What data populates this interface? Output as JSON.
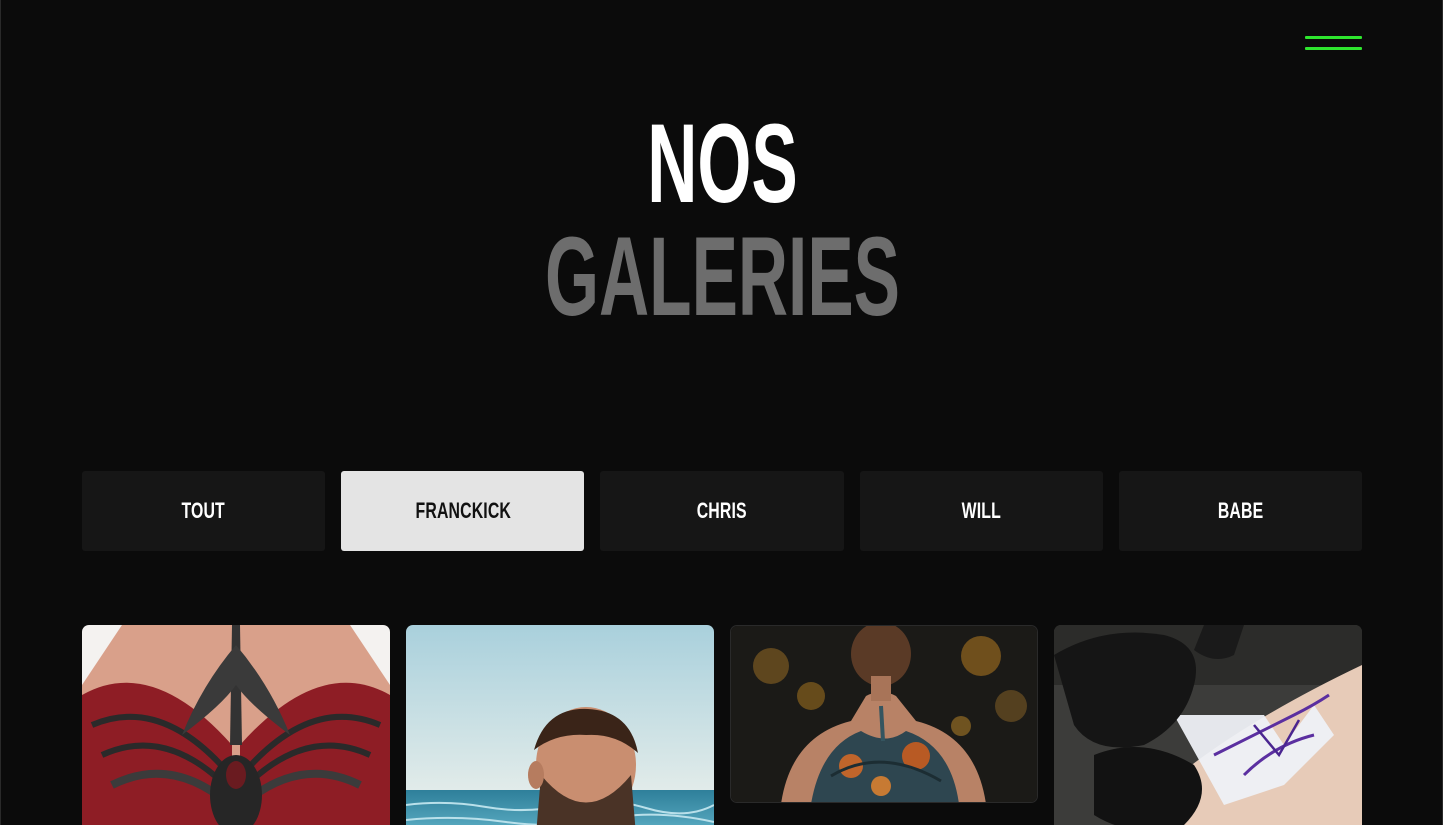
{
  "header": {
    "menu_icon": "hamburger-menu-icon",
    "accent_color": "#2ee62e"
  },
  "hero": {
    "title_line1": "NOS",
    "title_line2": "GALERIES"
  },
  "filters": {
    "tabs": [
      {
        "label": "TOUT",
        "active": false
      },
      {
        "label": "FRANCKICK",
        "active": true
      },
      {
        "label": "CHRIS",
        "active": false
      },
      {
        "label": "WILL",
        "active": false
      },
      {
        "label": "BABE",
        "active": false
      }
    ]
  },
  "gallery": {
    "items": [
      {
        "icon": "back-wings-tattoo-image"
      },
      {
        "icon": "man-at-sea-image"
      },
      {
        "icon": "woman-floral-back-tattoo-image"
      },
      {
        "icon": "tattoo-stencil-application-image"
      }
    ]
  }
}
